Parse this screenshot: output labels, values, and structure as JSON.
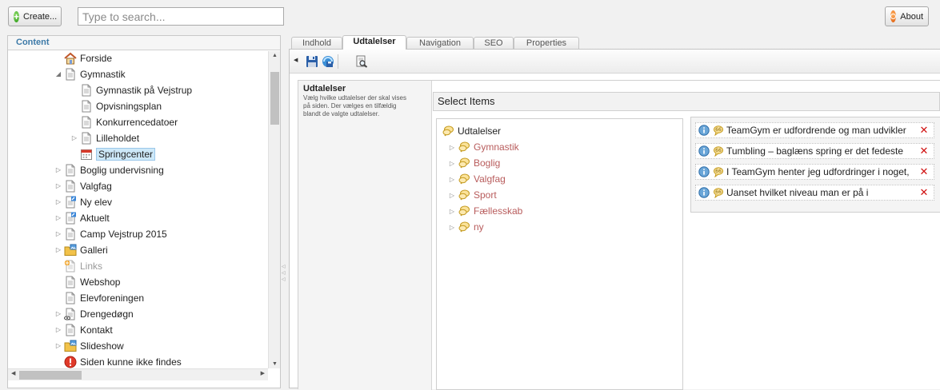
{
  "topbar": {
    "create_label": "Create...",
    "search_placeholder": "Type to search...",
    "about_label": "About"
  },
  "left": {
    "header": "Content",
    "tree": [
      {
        "label": "Forside",
        "icon": "home-icon",
        "arrow": ""
      },
      {
        "label": "Gymnastik",
        "icon": "document-icon",
        "arrow": "◢"
      },
      {
        "label": "Gymnastik på Vejstrup",
        "icon": "document-icon",
        "arrow": ""
      },
      {
        "label": "Opvisningsplan",
        "icon": "document-icon",
        "arrow": ""
      },
      {
        "label": "Konkurrencedatoer",
        "icon": "document-icon",
        "arrow": ""
      },
      {
        "label": "Lilleholdet",
        "icon": "document-icon",
        "arrow": "▷"
      },
      {
        "label": "Springcenter",
        "icon": "calendar-icon",
        "arrow": ""
      },
      {
        "label": "Boglig undervisning",
        "icon": "document-icon",
        "arrow": "▷"
      },
      {
        "label": "Valgfag",
        "icon": "document-icon",
        "arrow": "▷"
      },
      {
        "label": "Ny elev",
        "icon": "document-edit-icon",
        "arrow": "▷"
      },
      {
        "label": "Aktuelt",
        "icon": "document-edit-icon",
        "arrow": "▷"
      },
      {
        "label": "Camp Vejstrup 2015",
        "icon": "document-icon",
        "arrow": "▷"
      },
      {
        "label": "Galleri",
        "icon": "folder-image-icon",
        "arrow": "▷"
      },
      {
        "label": "Links",
        "icon": "document-new-icon",
        "arrow": ""
      },
      {
        "label": "Webshop",
        "icon": "document-icon",
        "arrow": ""
      },
      {
        "label": "Elevforeningen",
        "icon": "document-icon",
        "arrow": ""
      },
      {
        "label": "Drengedøgn",
        "icon": "document-hidden-icon",
        "arrow": "▷"
      },
      {
        "label": "Kontakt",
        "icon": "document-icon",
        "arrow": "▷"
      },
      {
        "label": "Slideshow",
        "icon": "folder-image-icon",
        "arrow": "▷"
      },
      {
        "label": "Siden kunne ikke findes",
        "icon": "warning-icon",
        "arrow": ""
      }
    ]
  },
  "tabs": [
    "Indhold",
    "Udtalelser",
    "Navigation",
    "SEO",
    "Properties"
  ],
  "property": {
    "title": "Udtalelser",
    "description": "Vælg hvilke udtalelser der skal vises på siden. Der vælges en tilfældig blandt de valgte udtalelser."
  },
  "picker": {
    "header": "Select Items",
    "root": "Udtalelser",
    "children": [
      "Gymnastik",
      "Boglig",
      "Valgfag",
      "Sport",
      "Fællesskab",
      "ny"
    ]
  },
  "selected": [
    "TeamGym er udfordrende og man udvikler",
    "Tumbling – baglæns spring er det fedeste",
    "I TeamGym henter jeg udfordringer i noget,",
    "Uanset hvilket niveau man er på i"
  ],
  "colors": {
    "link_red": "#b85c5c",
    "selection": "#cde8f8",
    "delete": "#d01010",
    "header_blue": "#3d7aa8"
  }
}
